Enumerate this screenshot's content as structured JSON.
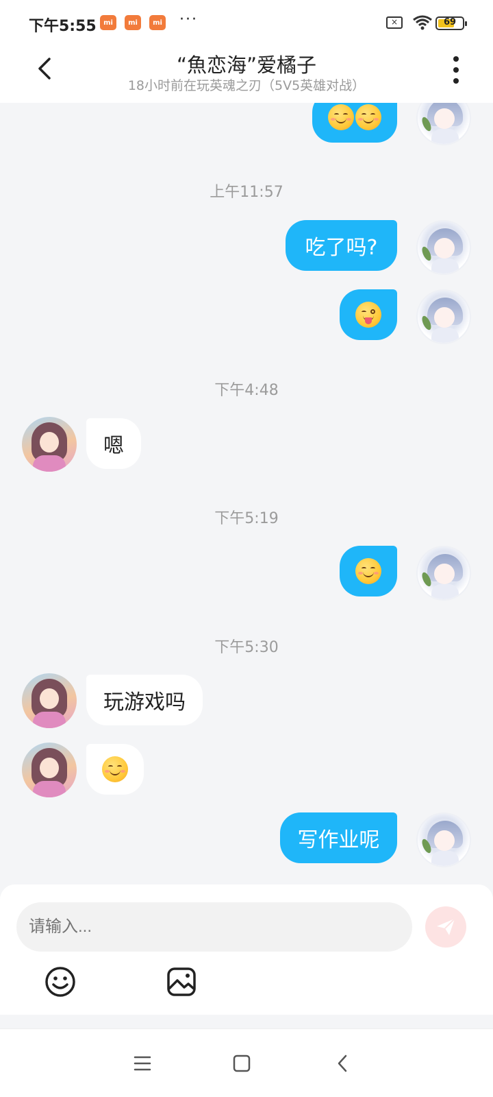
{
  "status_bar": {
    "time": "下午5:55",
    "notification_badges": [
      "mi",
      "mi",
      "mi"
    ],
    "more": "···",
    "battery_level": "69"
  },
  "header": {
    "title": "“魚恋海”爱橘子",
    "subtitle": "18小时前在玩英魂之刃（5V5英雄对战）"
  },
  "chat": {
    "dividers": [
      "上午11:57",
      "下午4:48",
      "下午5:19",
      "下午5:30"
    ],
    "messages": [
      {
        "from": "self",
        "kind": "emoji",
        "emoji": [
          "smiling-face",
          "smiling-face"
        ]
      },
      {
        "from": "self",
        "kind": "text",
        "text": "吃了吗?"
      },
      {
        "from": "self",
        "kind": "emoji",
        "emoji": [
          "winking-face-with-tongue"
        ]
      },
      {
        "from": "other",
        "kind": "text",
        "text": "嗯"
      },
      {
        "from": "self",
        "kind": "emoji",
        "emoji": [
          "smiling-face"
        ]
      },
      {
        "from": "other",
        "kind": "text",
        "text": "玩游戏吗"
      },
      {
        "from": "other",
        "kind": "emoji",
        "emoji": [
          "smiling-face"
        ]
      },
      {
        "from": "self",
        "kind": "text",
        "text": "写作业呢"
      }
    ]
  },
  "composer": {
    "placeholder": "请输入...",
    "send_icon": "paper-plane-icon",
    "tools": [
      "emoji-icon",
      "image-icon"
    ]
  },
  "nav_bar": {
    "buttons": [
      "menu-icon",
      "home-icon",
      "back-icon"
    ]
  },
  "colors": {
    "self_bubble": "#1fb6f9",
    "other_bubble": "#ffffff",
    "background": "#f4f5f7",
    "send_button": "#fde3e3"
  }
}
